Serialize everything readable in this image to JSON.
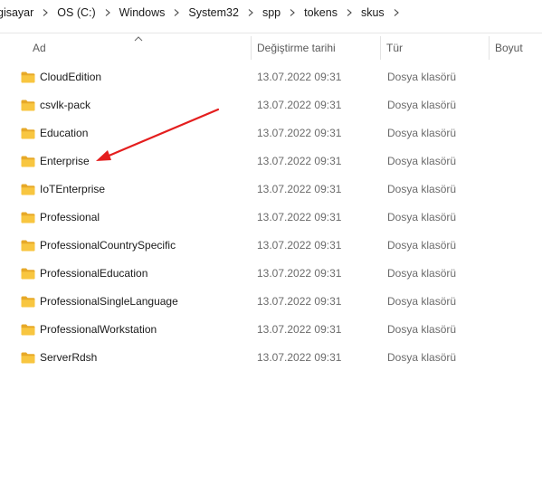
{
  "breadcrumb": {
    "items": [
      "gisayar",
      "OS (C:)",
      "Windows",
      "System32",
      "spp",
      "tokens",
      "skus"
    ]
  },
  "columns": {
    "name": "Ad",
    "modified": "Değiştirme tarihi",
    "type": "Tür",
    "size": "Boyut"
  },
  "files": [
    {
      "name": "CloudEdition",
      "modified": "13.07.2022 09:31",
      "type": "Dosya klasörü"
    },
    {
      "name": "csvlk-pack",
      "modified": "13.07.2022 09:31",
      "type": "Dosya klasörü"
    },
    {
      "name": "Education",
      "modified": "13.07.2022 09:31",
      "type": "Dosya klasörü"
    },
    {
      "name": "Enterprise",
      "modified": "13.07.2022 09:31",
      "type": "Dosya klasörü"
    },
    {
      "name": "IoTEnterprise",
      "modified": "13.07.2022 09:31",
      "type": "Dosya klasörü"
    },
    {
      "name": "Professional",
      "modified": "13.07.2022 09:31",
      "type": "Dosya klasörü"
    },
    {
      "name": "ProfessionalCountrySpecific",
      "modified": "13.07.2022 09:31",
      "type": "Dosya klasörü"
    },
    {
      "name": "ProfessionalEducation",
      "modified": "13.07.2022 09:31",
      "type": "Dosya klasörü"
    },
    {
      "name": "ProfessionalSingleLanguage",
      "modified": "13.07.2022 09:31",
      "type": "Dosya klasörü"
    },
    {
      "name": "ProfessionalWorkstation",
      "modified": "13.07.2022 09:31",
      "type": "Dosya klasörü"
    },
    {
      "name": "ServerRdsh",
      "modified": "13.07.2022 09:31",
      "type": "Dosya klasörü"
    }
  ],
  "icons": {
    "folder": "folder-icon",
    "separator": "chevron-right-icon",
    "sort": "sort-ascending-icon",
    "annotation": "red-arrow-annotation"
  },
  "colors": {
    "folder": "#f8c640",
    "folder_dark": "#e7a928",
    "annotation": "#e41e1e"
  }
}
